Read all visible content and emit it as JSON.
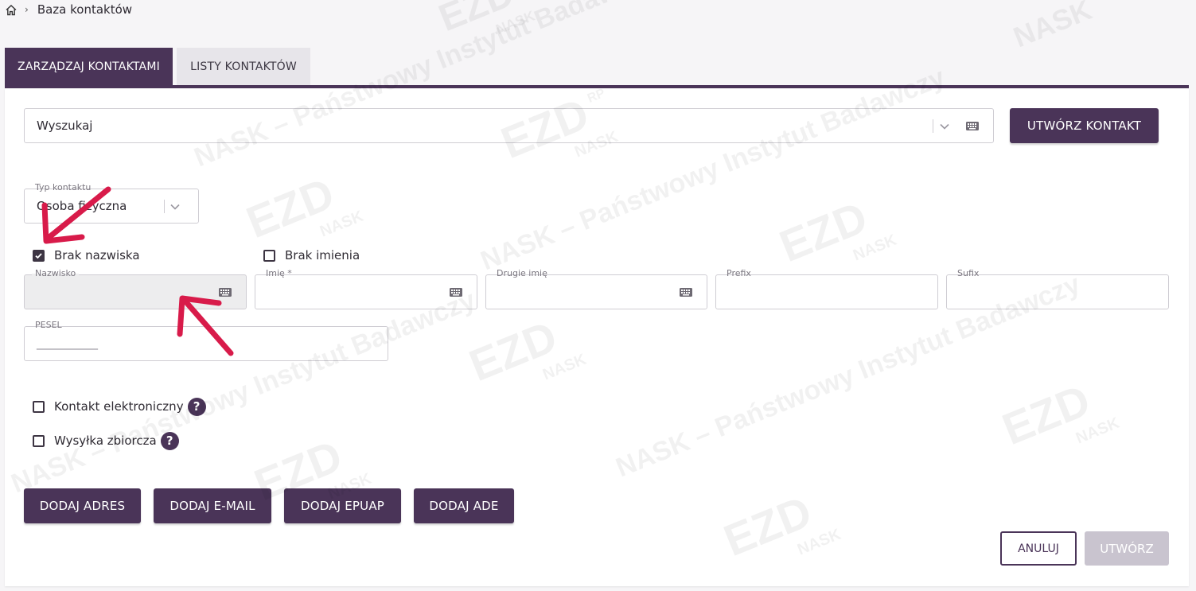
{
  "breadcrumb": {
    "home_icon": "home-icon",
    "current": "Baza kontaktów"
  },
  "tabs": [
    {
      "label": "ZARZĄDZAJ KONTAKTAMI",
      "active": true
    },
    {
      "label": "LISTY KONTAKTÓW",
      "active": false
    }
  ],
  "search": {
    "placeholder": "Wyszukaj",
    "value": ""
  },
  "create_contact_button": "UTWÓRZ KONTAKT",
  "contact_type": {
    "label": "Typ kontaktu",
    "value": "Osoba fizyczna"
  },
  "checkboxes": {
    "no_surname": {
      "label": "Brak nazwiska",
      "checked": true
    },
    "no_firstname": {
      "label": "Brak imienia",
      "checked": false
    },
    "electronic_contact": {
      "label": "Kontakt elektroniczny",
      "checked": false
    },
    "bulk_mailing": {
      "label": "Wysyłka zbiorcza",
      "checked": false
    }
  },
  "fields": {
    "surname": {
      "label": "Nazwisko",
      "value": "",
      "disabled": true
    },
    "firstname": {
      "label": "Imię *",
      "value": ""
    },
    "middle_name": {
      "label": "Drugie imię",
      "value": ""
    },
    "prefix": {
      "label": "Prefix",
      "value": ""
    },
    "suffix": {
      "label": "Sufix",
      "value": ""
    },
    "pesel": {
      "label": "PESEL",
      "value": "___________"
    }
  },
  "help_icon_glyph": "?",
  "add_buttons": {
    "address": "DODAJ ADRES",
    "email": "DODAJ E-MAIL",
    "epuap": "DODAJ EPUAP",
    "ade": "DODAJ ADE"
  },
  "footer": {
    "cancel": "ANULUJ",
    "create": "UTWÓRZ"
  },
  "watermark": {
    "brand": "EZD",
    "sup": "RP",
    "sub": "NASK",
    "text": "NASK – Państwowy Instytut Badawczy"
  },
  "colors": {
    "primary": "#4a3458",
    "annotation_arrow": "#d81b4a",
    "disabled_button": "#c9c4cf",
    "tab_inactive": "#e7e5ea"
  }
}
